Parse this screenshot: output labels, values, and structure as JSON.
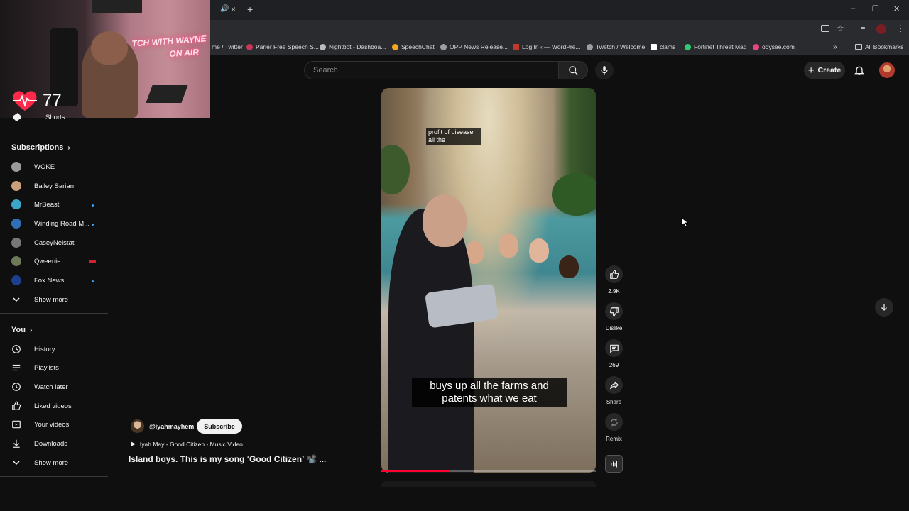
{
  "browser": {
    "tab_close": "×",
    "tab_add": "+",
    "window_controls": {
      "minimize": "–",
      "maximize": "❐",
      "close": "✕"
    },
    "bookmarks": [
      {
        "label": "me / Twitter",
        "color": "#1d1d1d"
      },
      {
        "label": "Parler Free Speech S...",
        "color": "#c6375a"
      },
      {
        "label": "Nightbot - Dashboa...",
        "color": "#bbbbbb"
      },
      {
        "label": "SpeechChat",
        "color": "#f5a623"
      },
      {
        "label": "OPP News Release...",
        "color": "#9e9e9e"
      },
      {
        "label": "Log In ‹ — WordPre...",
        "color": "#c0392b"
      },
      {
        "label": "Twetch / Welcome",
        "color": "#9e9e9e"
      },
      {
        "label": "clams",
        "color": "#111111"
      },
      {
        "label": "Fortinet Threat Map",
        "color": "#2ecc71"
      },
      {
        "label": "odysee.com",
        "color": "#e8467c"
      }
    ],
    "all_bookmarks": "All Bookmarks",
    "overflow": "»"
  },
  "header": {
    "search_placeholder": "Search",
    "create_label": "Create"
  },
  "webcam": {
    "neon_line1": "TCH WITH WAYNE",
    "neon_line2": "ON AIR",
    "heart_rate": "77"
  },
  "sidebar": {
    "shorts_label": "Shorts",
    "subscriptions_title": "Subscriptions",
    "subscriptions": [
      {
        "label": "WOKE",
        "avatar_color": "#9a9a9a",
        "badge": ""
      },
      {
        "label": "Bailey Sarian",
        "avatar_color": "#c9a07a",
        "badge": ""
      },
      {
        "label": "MrBeast",
        "avatar_color": "#3aa6c8",
        "badge": "dot"
      },
      {
        "label": "Winding Road M...",
        "avatar_color": "#2f6fb5",
        "badge": "dot"
      },
      {
        "label": "CaseyNeistat",
        "avatar_color": "#777777",
        "badge": ""
      },
      {
        "label": "Qweenie",
        "avatar_color": "#6c7a5a",
        "badge": "live"
      },
      {
        "label": "Fox News",
        "avatar_color": "#1c3f8f",
        "badge": "dot"
      }
    ],
    "subs_show_more": "Show more",
    "you_title": "You",
    "you_items": [
      {
        "label": "History",
        "icon": "history-icon"
      },
      {
        "label": "Playlists",
        "icon": "playlists-icon"
      },
      {
        "label": "Watch later",
        "icon": "watch-later-icon"
      },
      {
        "label": "Liked videos",
        "icon": "thumbs-up-icon"
      },
      {
        "label": "Your videos",
        "icon": "your-videos-icon"
      },
      {
        "label": "Downloads",
        "icon": "download-icon"
      }
    ],
    "you_show_more": "Show more"
  },
  "video": {
    "overlay_text": "profit of disease all the",
    "caption": "buys up all the farms and patents what we eat",
    "progress": 0.32
  },
  "actions": {
    "like_count": "2.9K",
    "dislike_label": "Dislike",
    "comment_count": "269",
    "share_label": "Share",
    "remix_label": "Remix"
  },
  "channel": {
    "handle": "@iyahmayhem",
    "subscribe_label": "Subscribe",
    "music": "Iyah May - Good Citizen - Music Video",
    "title": "Island boys. This is my song ‘Good Citizen’ 📽️ ..."
  },
  "colors": {
    "accent": "#ff0033",
    "background": "#0f0f0f",
    "unread_dot": "#3ea6ff"
  }
}
